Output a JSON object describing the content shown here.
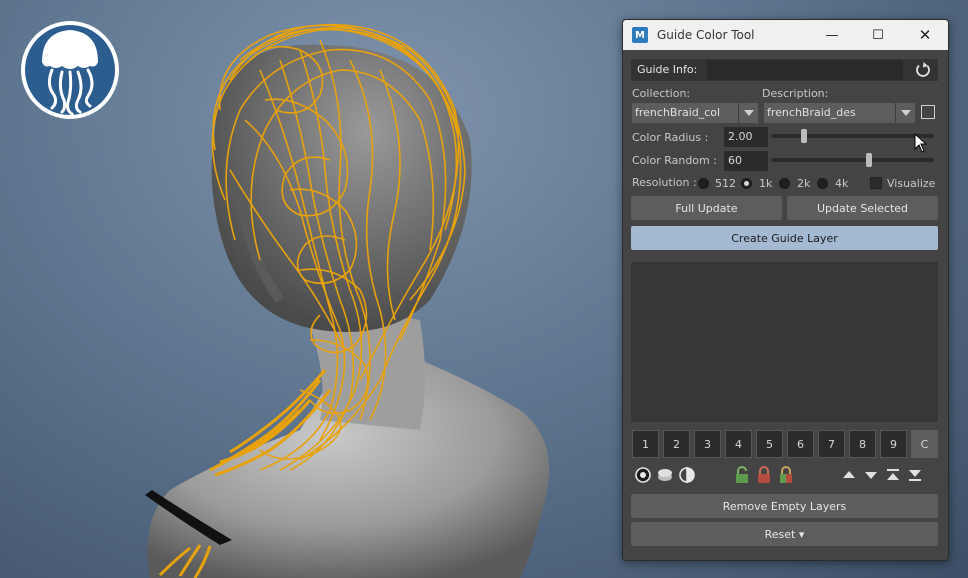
{
  "window": {
    "title": "Guide Color Tool",
    "app_icon_letter": "M",
    "minimize_glyph": "—",
    "maximize_glyph": "☐",
    "close_glyph": "✕"
  },
  "guide_info": {
    "label": "Guide Info:",
    "value": ""
  },
  "collection": {
    "label": "Collection:",
    "selected": "frenchBraid_col"
  },
  "description": {
    "label": "Description:",
    "selected": "frenchBraid_des"
  },
  "color_radius": {
    "label": "Color Radius :",
    "value": "2.00",
    "slider_fraction": 0.2
  },
  "color_random": {
    "label": "Color Random :",
    "value": "60",
    "slider_fraction": 0.6
  },
  "resolution": {
    "label": "Resolution :",
    "options": [
      "512",
      "1k",
      "2k",
      "4k"
    ],
    "selected": "1k",
    "visualize_label": "Visualize"
  },
  "buttons": {
    "full_update": "Full Update",
    "update_selected": "Update Selected",
    "create_guide_layer": "Create Guide Layer",
    "remove_empty_layers": "Remove Empty Layers",
    "reset": "Reset ▾"
  },
  "layer_slots": [
    "1",
    "2",
    "3",
    "4",
    "5",
    "6",
    "7",
    "8",
    "9",
    "C"
  ],
  "colors": {
    "hair": "#e8a20c",
    "panel_bg": "#444444",
    "primary_button": "#a4bad3",
    "logo_blue": "#2c5d8f"
  }
}
